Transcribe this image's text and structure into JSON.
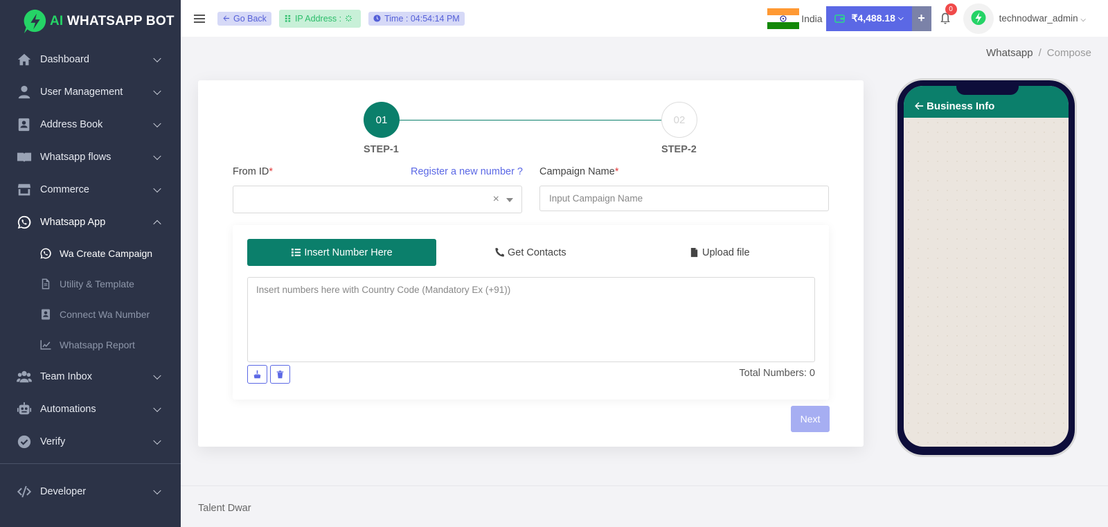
{
  "brand": {
    "ai": "AI",
    "name": " WHATSAPP BOT"
  },
  "sidebar": {
    "items": [
      {
        "label": "Dashboard"
      },
      {
        "label": "User Management"
      },
      {
        "label": "Address Book"
      },
      {
        "label": "Whatsapp flows"
      },
      {
        "label": "Commerce"
      },
      {
        "label": "Whatsapp App"
      },
      {
        "label": "Team Inbox"
      },
      {
        "label": "Automations"
      },
      {
        "label": "Verify"
      },
      {
        "label": "Developer"
      }
    ],
    "subitems": [
      {
        "label": "Wa Create Campaign"
      },
      {
        "label": "Utility & Template"
      },
      {
        "label": "Connect Wa Number"
      },
      {
        "label": "Whatsapp Report"
      }
    ]
  },
  "topbar": {
    "go_back": "Go Back",
    "ip_address": "IP Address :",
    "time": "Time : 04:54:14 PM",
    "country": "India",
    "wallet": "₹4,488.18",
    "add": "+",
    "notifications": "0",
    "username": "technodwar_admin"
  },
  "breadcrumb": {
    "home": "Whatsapp",
    "sep": "/",
    "current": "Compose"
  },
  "steps": {
    "step1_num": "01",
    "step1_label": "STEP-1",
    "step2_num": "02",
    "step2_label": "STEP-2"
  },
  "form": {
    "from_id_label": "From ID",
    "required_mark": "*",
    "register_link": "Register a new number ?",
    "campaign_label": "Campaign Name",
    "campaign_placeholder": "Input Campaign Name",
    "clear_x": "×"
  },
  "tabs": {
    "insert": "Insert Number Here",
    "contacts": "Get Contacts",
    "upload": "Upload file"
  },
  "numbers": {
    "placeholder": "Insert numbers here with Country Code (Mandatory Ex (+91))",
    "total": "Total Numbers: 0"
  },
  "next": "Next",
  "phone": {
    "title": "Business Info"
  },
  "footer": {
    "text": "Talent Dwar"
  },
  "colors": {
    "sidebar": "#2c3347",
    "accent": "#0b7f6b",
    "primary": "#5b68e5"
  }
}
